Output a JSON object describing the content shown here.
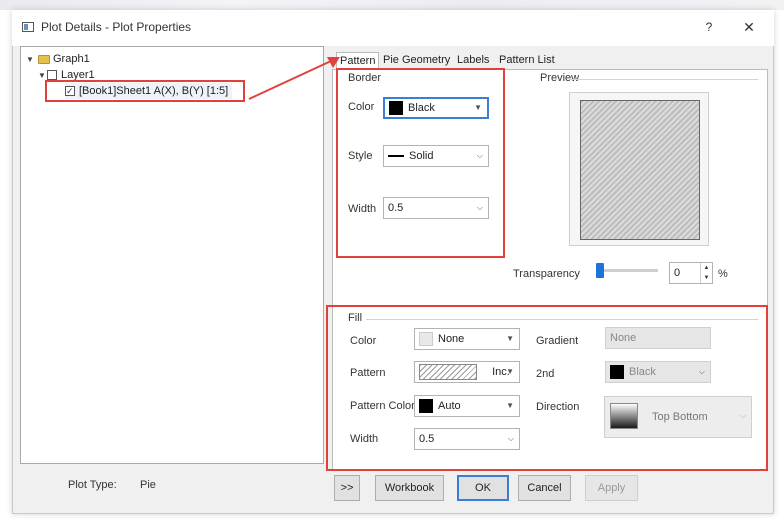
{
  "window": {
    "title": "Plot Details - Plot Properties",
    "help_glyph": "?",
    "close_glyph": "✕"
  },
  "tree": {
    "root": {
      "label": "Graph1",
      "expanded": true
    },
    "layer": {
      "label": "Layer1",
      "expanded": true
    },
    "plot": {
      "label": "[Book1]Sheet1 A(X), B(Y) [1:5]",
      "checked": true
    }
  },
  "plot_type": {
    "label": "Plot Type:",
    "value": "Pie"
  },
  "tabs": [
    "Pattern",
    "Pie Geometry",
    "Labels",
    "Pattern List"
  ],
  "active_tab": "Pattern",
  "border": {
    "group_label": "Border",
    "color": {
      "label": "Color",
      "value": "Black",
      "swatch": "#000000"
    },
    "style": {
      "label": "Style",
      "value": "Solid"
    },
    "width": {
      "label": "Width",
      "value": "0.5"
    }
  },
  "preview": {
    "label": "Preview"
  },
  "transparency": {
    "label": "Transparency",
    "value": "0",
    "unit": "%",
    "level_percent": 0
  },
  "fill": {
    "group_label": "Fill",
    "color": {
      "label": "Color",
      "value": "None",
      "swatch": "#e8e8e8"
    },
    "pattern": {
      "label": "Pattern",
      "value": "Inc."
    },
    "pattern_color": {
      "label": "Pattern Color",
      "value": "Auto",
      "swatch": "#000000"
    },
    "width": {
      "label": "Width",
      "value": "0.5"
    },
    "gradient": {
      "label": "Gradient",
      "value": "None"
    },
    "second": {
      "label": "2nd",
      "value": "Black",
      "swatch": "#000000"
    },
    "direction": {
      "label": "Direction",
      "value": "Top Bottom"
    }
  },
  "buttons": {
    "expand": ">>",
    "workbook": "Workbook",
    "ok": "OK",
    "cancel": "Cancel",
    "apply": "Apply"
  },
  "colors": {
    "accent": "#3b7fd4",
    "highlight": "#e0413b",
    "slider": "#1e73d8"
  }
}
